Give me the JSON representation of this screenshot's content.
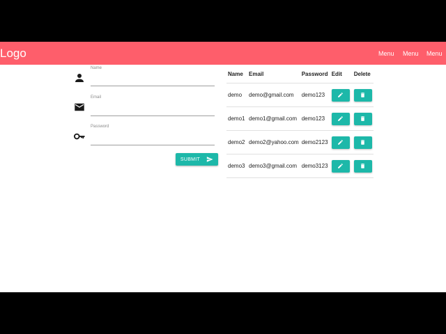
{
  "nav": {
    "logo": "Logo",
    "menu_items": [
      "Menu",
      "Menu",
      "Menu"
    ],
    "color": "#fe5e6b"
  },
  "form": {
    "fields": [
      {
        "label": "Name",
        "value": "",
        "icon": "person-icon"
      },
      {
        "label": "Email",
        "value": "",
        "icon": "mail-icon"
      },
      {
        "label": "Password",
        "value": "",
        "icon": "key-icon"
      }
    ],
    "submit_label": "SUBMIT",
    "submit_icon": "send-icon"
  },
  "table": {
    "headers": [
      "Name",
      "Email",
      "Password",
      "Edit",
      "Delete"
    ],
    "rows": [
      {
        "name": "demo",
        "email": "demo@gmail.com",
        "password": "demo123"
      },
      {
        "name": "demo1",
        "email": "demo1@gmail.com",
        "password": "demo123"
      },
      {
        "name": "demo2",
        "email": "demo2@yahoo.com",
        "password": "demo2123"
      },
      {
        "name": "demo3",
        "email": "demo3@gmail.com",
        "password": "demo3123"
      }
    ],
    "edit_icon": "pencil-icon",
    "delete_icon": "trash-icon"
  },
  "accent_color": "#1db8a9"
}
